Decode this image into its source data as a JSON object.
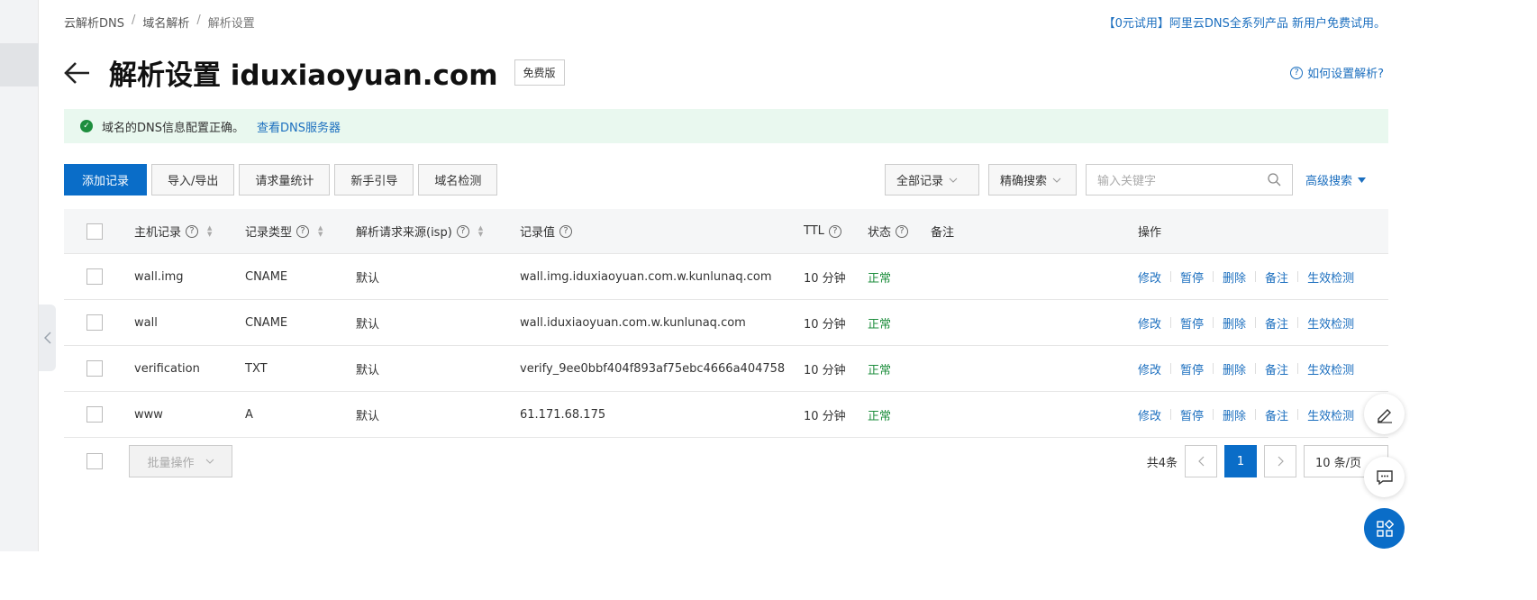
{
  "breadcrumb": [
    "云解析DNS",
    "域名解析",
    "解析设置"
  ],
  "promo": "【0元试用】阿里云DNS全系列产品 新用户免费试用。",
  "page_title": "解析设置 iduxiaoyuan.com",
  "badge": "免费版",
  "help_link": "如何设置解析?",
  "notice": {
    "text": "域名的DNS信息配置正确。",
    "link": "查看DNS服务器"
  },
  "toolbar": {
    "add": "添加记录",
    "import_export": "导入/导出",
    "stats": "请求量统计",
    "guide": "新手引导",
    "check": "域名检测",
    "filter": "全部记录",
    "search_mode": "精确搜索",
    "search_placeholder": "输入关键字",
    "advanced": "高级搜索"
  },
  "columns": {
    "host": "主机记录",
    "type": "记录类型",
    "isp": "解析请求来源(isp)",
    "value": "记录值",
    "ttl": "TTL",
    "status": "状态",
    "remark": "备注",
    "ops": "操作"
  },
  "rows": [
    {
      "host": "wall.img",
      "type": "CNAME",
      "isp": "默认",
      "value": "wall.img.iduxiaoyuan.com.w.kunlunaq.com",
      "ttl": "10 分钟",
      "status": "正常"
    },
    {
      "host": "wall",
      "type": "CNAME",
      "isp": "默认",
      "value": "wall.iduxiaoyuan.com.w.kunlunaq.com",
      "ttl": "10 分钟",
      "status": "正常"
    },
    {
      "host": "verification",
      "type": "TXT",
      "isp": "默认",
      "value": "verify_9ee0bbf404f893af75ebc4666a404758",
      "ttl": "10 分钟",
      "status": "正常"
    },
    {
      "host": "www",
      "type": "A",
      "isp": "默认",
      "value": "61.171.68.175",
      "ttl": "10 分钟",
      "status": "正常"
    }
  ],
  "row_ops": {
    "edit": "修改",
    "pause": "暂停",
    "delete": "删除",
    "remark": "备注",
    "verify": "生效检测"
  },
  "footer": {
    "batch": "批量操作",
    "total": "共4条",
    "page": "1",
    "page_size": "10 条/页"
  },
  "colors": {
    "primary": "#0a6dc8",
    "link": "#1c6fbf",
    "success": "#1e8e3e",
    "notice_bg": "#e9f8ef"
  }
}
